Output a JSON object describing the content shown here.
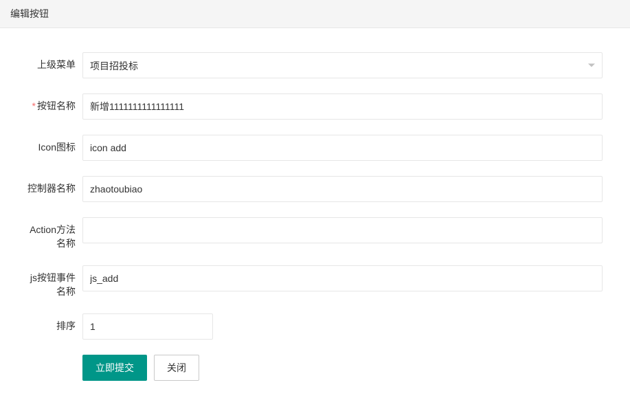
{
  "header": {
    "title": "编辑按钮"
  },
  "form": {
    "parent_menu": {
      "label": "上级菜单",
      "value": "项目招投标"
    },
    "button_name": {
      "label": "按钮名称",
      "required_mark": "*",
      "value": "新增1111111111111111"
    },
    "icon": {
      "label": "Icon图标",
      "value": "icon add"
    },
    "controller": {
      "label": "控制器名称",
      "value": "zhaotoubiao"
    },
    "action": {
      "label": "Action方法名称",
      "value": ""
    },
    "js_event": {
      "label": "js按钮事件名称",
      "value": "js_add"
    },
    "sort": {
      "label": "排序",
      "value": "1"
    }
  },
  "buttons": {
    "submit": "立即提交",
    "close": "关闭"
  }
}
